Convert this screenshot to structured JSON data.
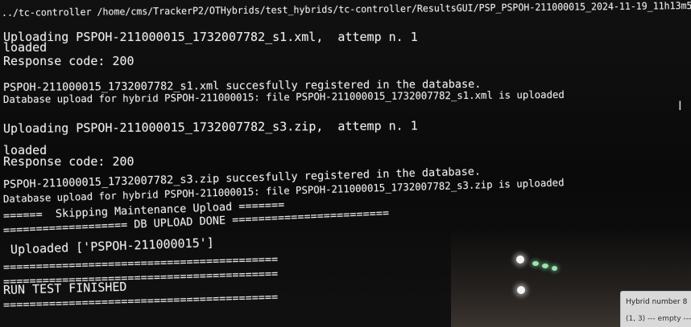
{
  "terminal": {
    "path_line": "../tc-controller /home/cms/TrackerP2/OTHybrids/test_hybrids/tc-controller/ResultsGUI/PSP_PSPOH-211000015_2024-11-19_11h13m56s/",
    "lines": [
      "Uploading PSPOH-211000015_1732007782_s1.xml,  attemp n. 1",
      "loaded",
      "Response code: 200",
      "PSPOH-211000015_1732007782_s1.xml succesfully registered in the database.",
      "Database upload for hybrid PSPOH-211000015: file PSPOH-211000015_1732007782_s1.xml is uploaded",
      "Uploading PSPOH-211000015_1732007782_s3.zip,  attemp n. 1",
      "loaded",
      "Response code: 200",
      "PSPOH-211000015_1732007782_s3.zip succesfully registered in the database.",
      "Database upload for hybrid PSPOH-211000015: file PSPOH-211000015_1732007782_s3.zip is uploaded",
      "======  Skipping Maintenance Upload =======",
      "=================== DB UPLOAD DONE ========================",
      " Uploaded ['PSPOH-211000015']",
      "==========================================",
      "==========================================",
      "RUN TEST FINISHED",
      "=========================================="
    ]
  },
  "gui_panel": {
    "title": "Hybrid number 8",
    "slot": "(1, 3) --- empty ---"
  },
  "icons": {
    "text_cursor": "ibeam-cursor-icon"
  }
}
